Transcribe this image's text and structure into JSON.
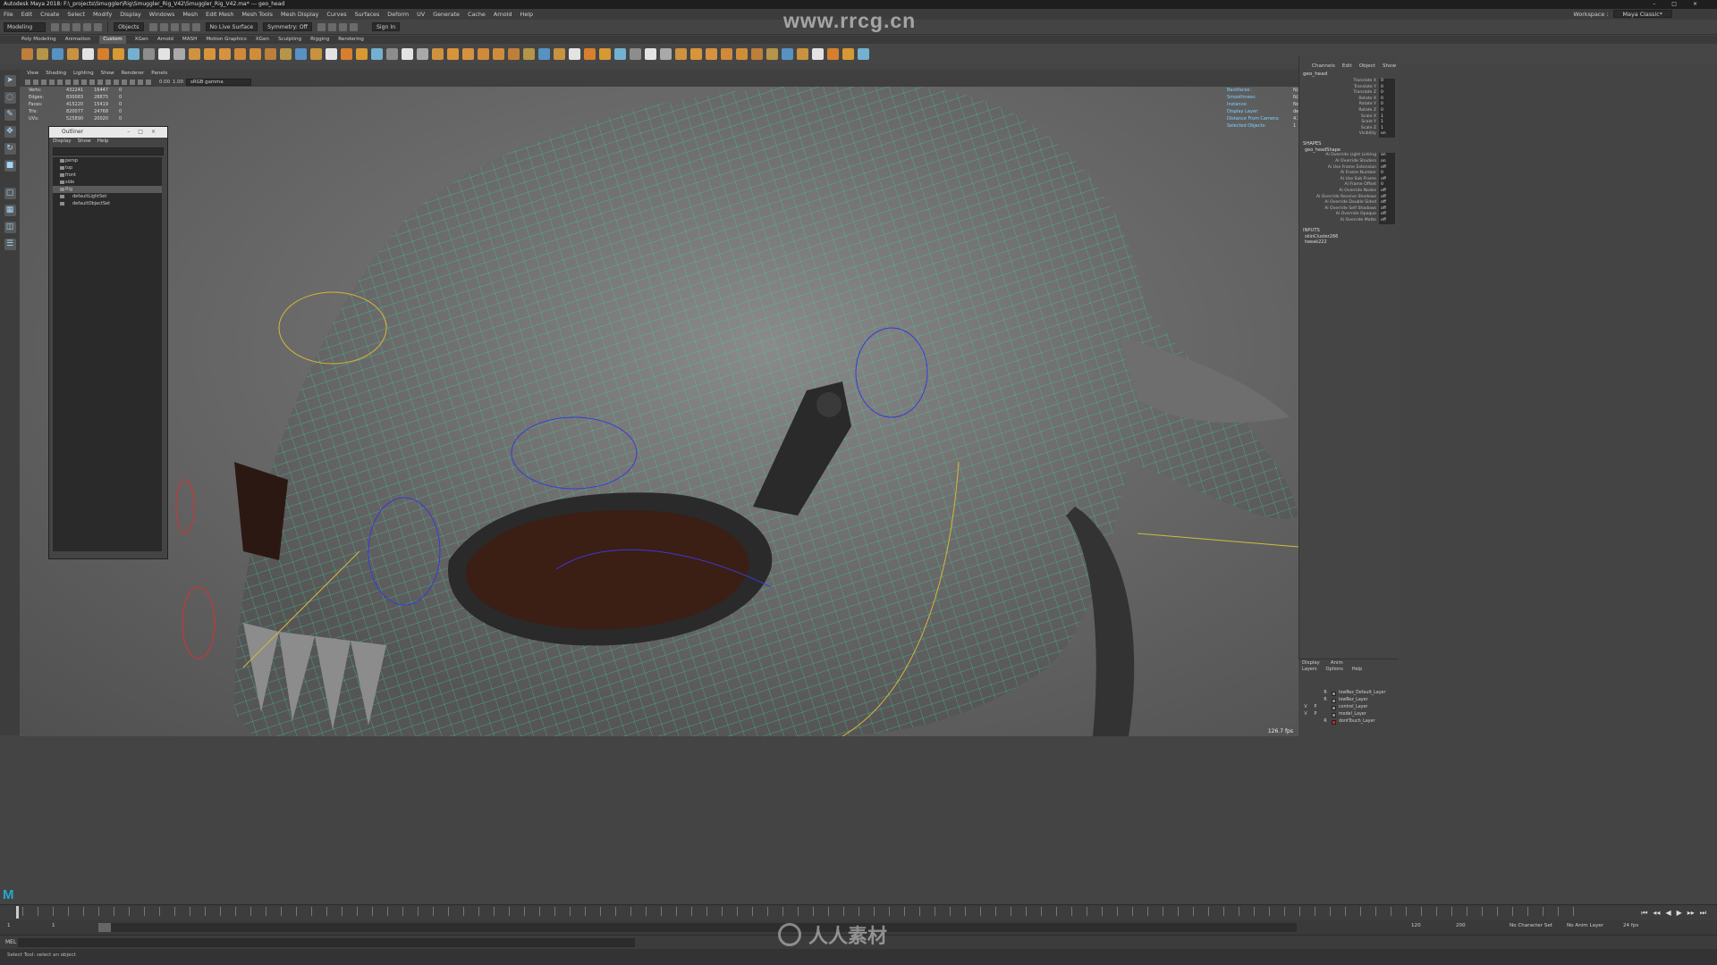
{
  "window": {
    "title": "Autodesk Maya 2018: F:\\_projects\\Smuggler\\Rig\\Smuggler_Rig_V42\\Smuggler_Rig_V42.ma*  ---  geo_head"
  },
  "watermark_top": "www.rrcg.cn",
  "watermark_bottom": "人人素材",
  "menubar": {
    "items": [
      "File",
      "Edit",
      "Create",
      "Select",
      "Modify",
      "Display",
      "Windows",
      "Mesh",
      "Edit Mesh",
      "Mesh Tools",
      "Mesh Display",
      "Curves",
      "Surfaces",
      "Deform",
      "UV",
      "Generate",
      "Cache",
      "Arnold",
      "Help"
    ],
    "workspace_label": "Workspace :",
    "workspace_value": "Maya Classic*"
  },
  "status_line": {
    "mode": "Modeling",
    "objects_label": "Objects",
    "symmetry": "Symmetry: Off",
    "live_surface": "No Live Surface",
    "sign_in": "Sign In"
  },
  "shelf": {
    "tabs": [
      "Poly Modeling",
      "Animation",
      "Custom",
      "XGen",
      "Arnold",
      "MASH",
      "Motion Graphics",
      "XGen",
      "Sculpting",
      "Rigging",
      "Rendering"
    ],
    "active_tab": "Custom",
    "icon_colors": [
      "#d48a3a",
      "#c9a34a",
      "#5aa0d8",
      "#e0a040",
      "#ffffff",
      "#f08a2a",
      "#f0a830",
      "#7cc3e8",
      "#9a9a9a",
      "#ffffff",
      "#bbbbbb",
      "#e8a040",
      "#f2a23a",
      "#f0a040",
      "#ea9638",
      "#e89a3a"
    ]
  },
  "panel": {
    "menu": [
      "View",
      "Shading",
      "Lighting",
      "Show",
      "Renderer",
      "Panels"
    ],
    "gamma": "sRGB gamma",
    "exposure": "0.00",
    "gamma_value": "1.00"
  },
  "hud_left": [
    {
      "label": "Verts:",
      "a": "432241",
      "b": "16447",
      "c": "0"
    },
    {
      "label": "Edges:",
      "a": "830083",
      "b": "28875",
      "c": "0"
    },
    {
      "label": "Faces:",
      "a": "415220",
      "b": "15419",
      "c": "0"
    },
    {
      "label": "Tris:",
      "a": "820077",
      "b": "24768",
      "c": "0"
    },
    {
      "label": "UVs:",
      "a": "525890",
      "b": "20020",
      "c": "0"
    }
  ],
  "hud_right": [
    {
      "label": "Backfaces:",
      "value": "N/A"
    },
    {
      "label": "Smoothness:",
      "value": "N/A"
    },
    {
      "label": "Instance:",
      "value": "No"
    },
    {
      "label": "Display Layer:",
      "value": "default"
    },
    {
      "label": "Distance From Camera:",
      "value": "4.101"
    },
    {
      "label": "Selected Objects:",
      "value": "1"
    }
  ],
  "fps": "126.7 fps",
  "outliner": {
    "title": "Outliner",
    "menu": [
      "Display",
      "Show",
      "Help"
    ],
    "items": [
      "persp",
      "top",
      "front",
      "side",
      "Rig",
      "defaultLightSet",
      "defaultObjectSet"
    ],
    "selected_index": 4
  },
  "channel_box": {
    "menu": [
      "Channels",
      "Edit",
      "Object",
      "Show"
    ],
    "object": "geo_head",
    "attributes": [
      {
        "name": "Translate X",
        "value": "0"
      },
      {
        "name": "Translate Y",
        "value": "0"
      },
      {
        "name": "Translate Z",
        "value": "0"
      },
      {
        "name": "Rotate X",
        "value": "0"
      },
      {
        "name": "Rotate Y",
        "value": "0"
      },
      {
        "name": "Rotate Z",
        "value": "0"
      },
      {
        "name": "Scale X",
        "value": "1"
      },
      {
        "name": "Scale Y",
        "value": "1"
      },
      {
        "name": "Scale Z",
        "value": "1"
      },
      {
        "name": "Visibility",
        "value": "on"
      }
    ],
    "shapes_header": "SHAPES",
    "shape_name": "geo_headShape",
    "shape_attrs": [
      {
        "name": "Ai Override Light Linking",
        "value": "on"
      },
      {
        "name": "Ai Override Shaders",
        "value": "on"
      },
      {
        "name": "Ai Use Frame Extension",
        "value": "off"
      },
      {
        "name": "Ai Frame Number",
        "value": "0"
      },
      {
        "name": "Ai Use Sub Frame",
        "value": "off"
      },
      {
        "name": "Ai Frame Offset",
        "value": "0"
      },
      {
        "name": "Ai Override Nodes",
        "value": "off"
      },
      {
        "name": "Ai Override Receive Shadows",
        "value": "off"
      },
      {
        "name": "Ai Override Double Sided",
        "value": "off"
      },
      {
        "name": "Ai Override Self Shadows",
        "value": "off"
      },
      {
        "name": "Ai Override Opaque",
        "value": "off"
      },
      {
        "name": "Ai Override Matte",
        "value": "off"
      }
    ],
    "inputs_header": "INPUTS",
    "inputs": [
      "skinCluster266",
      "tweak222"
    ]
  },
  "layer_editor": {
    "tabs": [
      "Display",
      "Anim"
    ],
    "menu": [
      "Layers",
      "Options",
      "Help"
    ],
    "layers": [
      {
        "v": "",
        "p": "",
        "r": "R",
        "name": "lowRez_Default_Layer",
        "color": "#8a8a8a"
      },
      {
        "v": "",
        "p": "",
        "r": "R",
        "name": "lowRez_Layer",
        "color": "#8a8a8a"
      },
      {
        "v": "V",
        "p": "P",
        "r": "",
        "name": "control_Layer",
        "color": "#8a8a8a"
      },
      {
        "v": "V",
        "p": "P",
        "r": "",
        "name": "model_Layer",
        "color": "#8a8a8a"
      },
      {
        "v": "",
        "p": "",
        "r": "R",
        "name": "dontTouch_Layer",
        "color": "#d02020"
      }
    ]
  },
  "time": {
    "start": "1",
    "range_start": "1",
    "range_end": "120",
    "end": "200",
    "character_set": "No Character Set",
    "anim_layer": "No Anim Layer",
    "fps": "24 fps"
  },
  "command_line": {
    "lang": "MEL"
  },
  "help_line": "Select Tool: select an object"
}
